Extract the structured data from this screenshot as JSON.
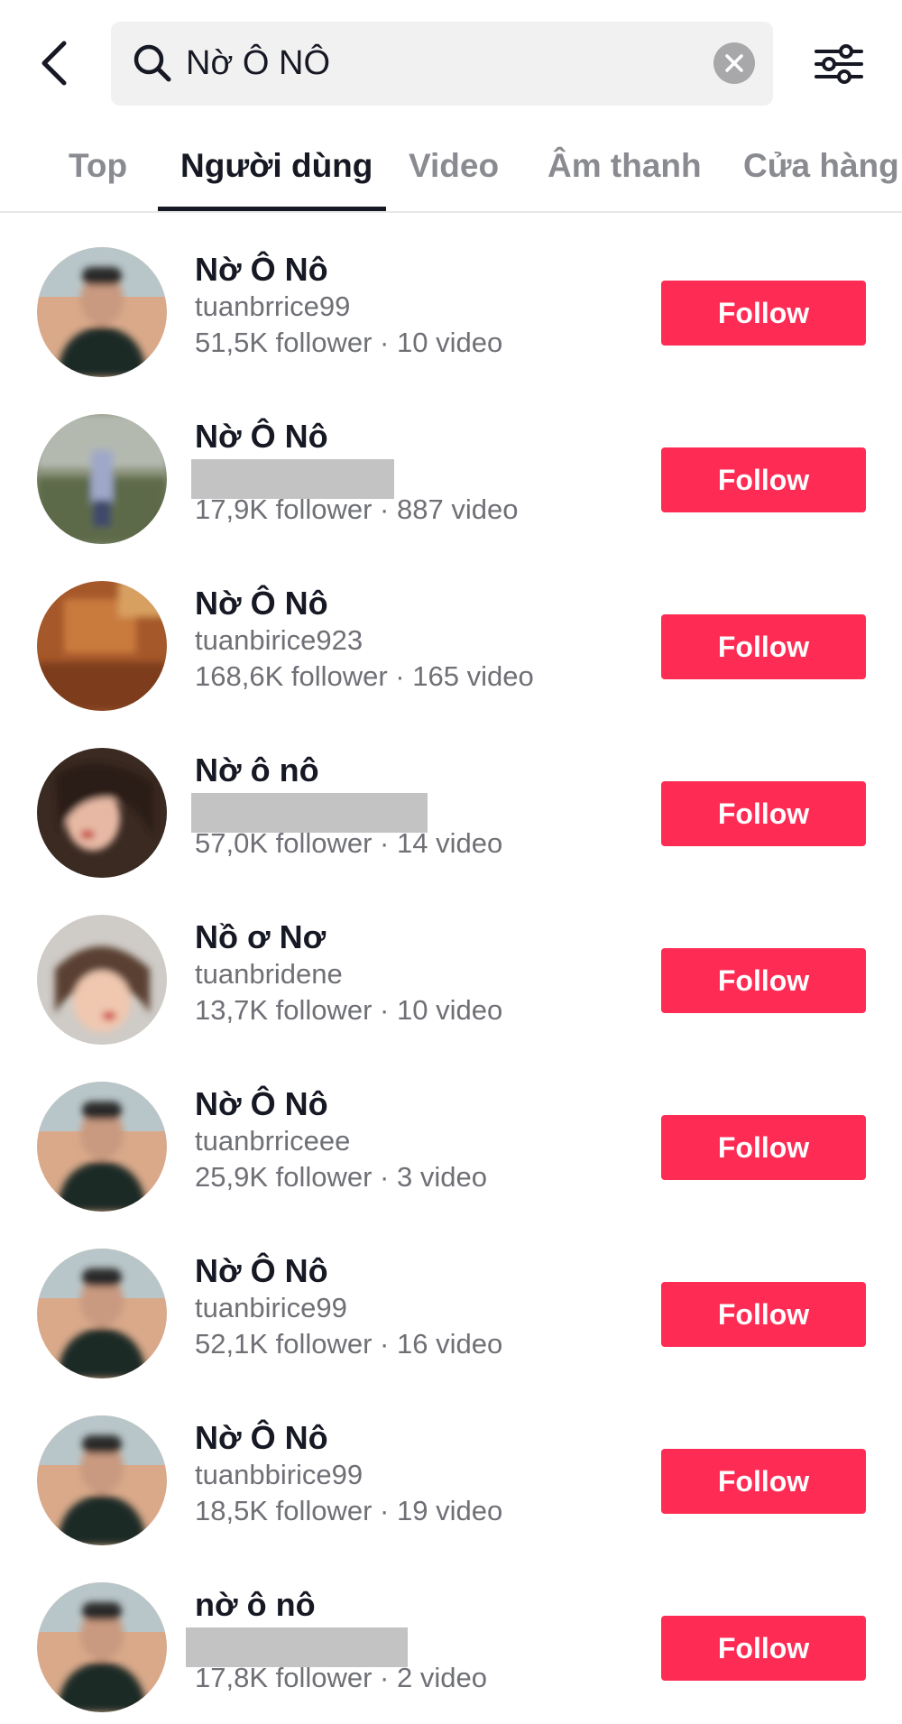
{
  "search": {
    "query": "Nờ Ô NÔ"
  },
  "icons": {
    "back": "chevron-left-icon",
    "search": "search-icon",
    "clear": "clear-icon",
    "filter": "filter-sliders-icon"
  },
  "colors": {
    "accent": "#fe2c55",
    "text_primary": "#161823",
    "text_secondary": "#6f7076",
    "tab_inactive": "#8a8b91"
  },
  "tabs": [
    {
      "label": "Top",
      "active": false
    },
    {
      "label": "Người dùng",
      "active": true
    },
    {
      "label": "Video",
      "active": false
    },
    {
      "label": "Âm thanh",
      "active": false
    },
    {
      "label": "Cửa hàng",
      "active": false
    }
  ],
  "follow_label": "Follow",
  "users": [
    {
      "name": "Nờ Ô Nô",
      "handle": "tuanbrrice99",
      "stats": "51,5K follower · 10 video",
      "handle_redacted": false
    },
    {
      "name": "Nờ Ô Nô",
      "handle": "",
      "stats": "17,9K follower · 887 video",
      "handle_redacted": true
    },
    {
      "name": "Nờ Ô Nô",
      "handle": "tuanbirice923",
      "stats": "168,6K follower · 165 video",
      "handle_redacted": false
    },
    {
      "name": "Nờ ô nô",
      "handle": "",
      "stats": "57,0K follower · 14 video",
      "handle_redacted": true
    },
    {
      "name": "Nồ ơ Nơ",
      "handle": "tuanbridene",
      "stats": "13,7K follower · 10 video",
      "handle_redacted": false
    },
    {
      "name": "Nờ Ô Nô",
      "handle": "tuanbrriceee",
      "stats": "25,9K follower · 3 video",
      "handle_redacted": false
    },
    {
      "name": "Nờ Ô Nô",
      "handle": "tuanbirice99",
      "stats": "52,1K follower · 16 video",
      "handle_redacted": false
    },
    {
      "name": "Nờ Ô Nô",
      "handle": "tuanbbirice99",
      "stats": "18,5K follower · 19 video",
      "handle_redacted": false
    },
    {
      "name": "nờ ô nô",
      "handle": "",
      "stats": "17,8K follower · 2 video",
      "handle_redacted": true
    }
  ]
}
